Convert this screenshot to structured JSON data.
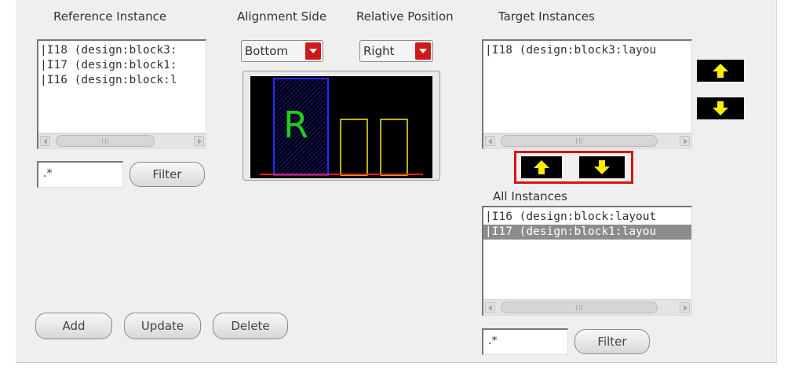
{
  "headers": {
    "reference": "Reference Instance",
    "alignment": "Alignment Side",
    "relative": "Relative Position",
    "target": "Target Instances",
    "all": "All Instances"
  },
  "reference_list": {
    "items": [
      "|I18 (design:block3:",
      "|I17 (design:block1:",
      "|I16 (design:block:l"
    ]
  },
  "reference_filter": {
    "value": ".*",
    "button": "Filter"
  },
  "alignment_side": {
    "value": "Bottom"
  },
  "relative_position": {
    "value": "Right"
  },
  "preview": {
    "reference_letter": "R",
    "colors": {
      "background": "#000000",
      "reference": "#1d1dd8",
      "letter": "#22cc22",
      "target": "#e8e000",
      "baseline": "#ff2020"
    }
  },
  "target_list": {
    "items": [
      "|I18 (design:block3:layou"
    ]
  },
  "all_list": {
    "items": [
      "|I16 (design:block:layout",
      "|I17 (design:block1:layou"
    ],
    "selected_index": 1
  },
  "all_filter": {
    "value": ".*",
    "button": "Filter"
  },
  "buttons": {
    "add": "Add",
    "update": "Update",
    "delete": "Delete"
  },
  "icons": {
    "move_up": "arrow-up-icon",
    "move_down": "arrow-down-icon",
    "highlight": "#e01010",
    "arrow_color": "#ffee00"
  }
}
